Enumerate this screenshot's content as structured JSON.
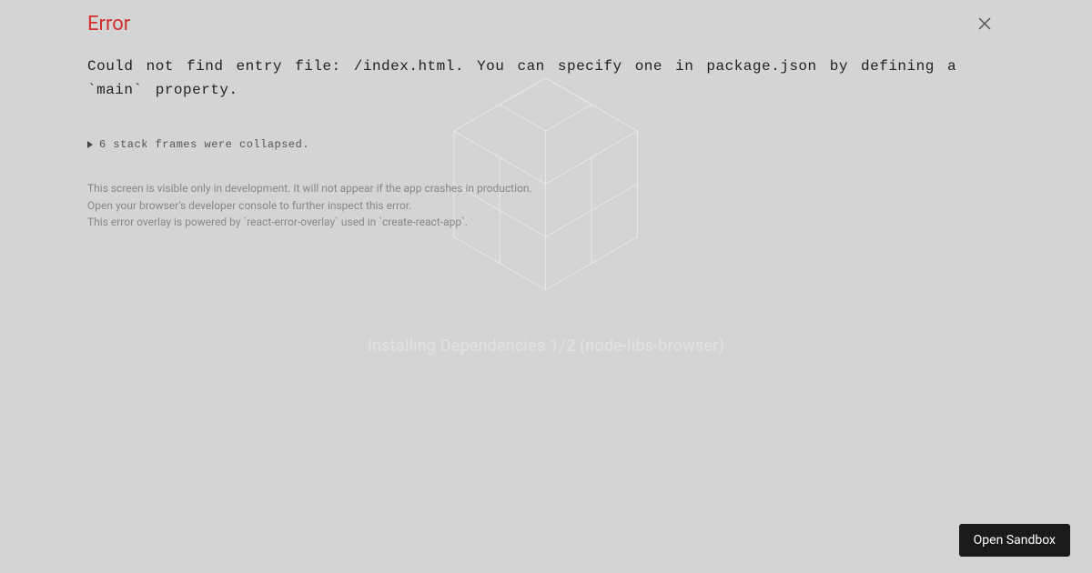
{
  "background": {
    "loading_text": "Installing Dependencies 1/2 (node-libs-browser)"
  },
  "error": {
    "title": "Error",
    "message": "Could not find entry file: /index.html. You can specify one in package.json by defining a `main` property.",
    "stack_toggle": "6 stack frames were collapsed.",
    "footer_line1": "This screen is visible only in development. It will not appear if the app crashes in production.",
    "footer_line2": "Open your browser's developer console to further inspect this error.",
    "footer_line3": "This error overlay is powered by `react-error-overlay` used in `create-react-app`."
  },
  "buttons": {
    "open_sandbox": "Open Sandbox"
  }
}
